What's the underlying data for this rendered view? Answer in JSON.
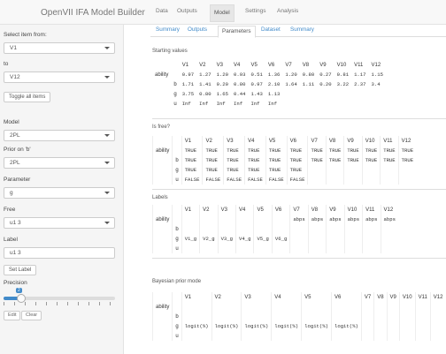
{
  "navbar": {
    "brand": "OpenVII IFA Model Builder",
    "items": [
      "Data",
      "Outputs",
      "Model",
      "Settings",
      "Analysis"
    ],
    "active_index": 2
  },
  "sidebar": {
    "select_item_label": "Select item from:",
    "select_item_value": "V1",
    "to_label": "to",
    "to_value": "V12",
    "toggle_button": "Toggle all items",
    "model_label": "Model",
    "model_value": "2PL",
    "prior_label": "Prior on 'b'",
    "prior_value": "2PL",
    "parameter_label": "Parameter",
    "parameter_value": "g",
    "free_label": "Free",
    "free_value": "u1 3",
    "label_label": "Label",
    "label_value": "u1 3",
    "set_label_button": "Set Label",
    "precision_label": "Precision",
    "slider_value": "2",
    "small_buttons": [
      "Edit",
      "Clear"
    ]
  },
  "tabs": {
    "items": [
      "Summary",
      "Outputs",
      "Parameters",
      "Dataset",
      "Summary"
    ],
    "active_index": 2
  },
  "sections": {
    "starting_values": "Starting values",
    "free": "Is free?",
    "labels": "Labels",
    "bayesian_priors": "Bayesian prior mode"
  },
  "starting_values": {
    "columns": [
      "",
      "",
      "V1",
      "V2",
      "V3",
      "V4",
      "V5",
      "V6",
      "V7",
      "V8",
      "V9",
      "V10",
      "V11",
      "V12"
    ],
    "rows": [
      [
        "ability",
        "",
        "0.97",
        "1.27",
        "1.20",
        "0.93",
        "0.51",
        "1.36",
        "1.20",
        "0.80",
        "0.27",
        "0.81",
        "1.17",
        "1.15"
      ],
      [
        "",
        "b",
        "1.71",
        "1.41",
        "0.20",
        "0.80",
        "0.97",
        "2.10",
        "1.64",
        "1.11",
        "0.20",
        "3.22",
        "2.37",
        "3.4"
      ],
      [
        "",
        "g",
        "3.75",
        "0.80",
        "1.65",
        "0.44",
        "1.43",
        "1.13",
        "",
        "",
        "",
        "",
        "",
        ""
      ],
      [
        "",
        "u",
        "Inf",
        "Inf",
        "Inf",
        "Inf",
        "Inf",
        "Inf",
        "",
        "",
        "",
        "",
        "",
        ""
      ]
    ]
  },
  "free": {
    "columns": [
      "",
      "",
      "V1",
      "V2",
      "V3",
      "V4",
      "V5",
      "V6",
      "V7",
      "V8",
      "V9",
      "V10",
      "V11",
      "V12"
    ],
    "rows": [
      [
        "ability",
        "",
        "TRUE",
        "TRUE",
        "TRUE",
        "TRUE",
        "TRUE",
        "TRUE",
        "TRUE",
        "TRUE",
        "TRUE",
        "TRUE",
        "TRUE",
        "TRUE"
      ],
      [
        "",
        "b",
        "TRUE",
        "TRUE",
        "TRUE",
        "TRUE",
        "TRUE",
        "TRUE",
        "TRUE",
        "TRUE",
        "TRUE",
        "TRUE",
        "TRUE",
        "TRUE"
      ],
      [
        "",
        "g",
        "TRUE",
        "TRUE",
        "TRUE",
        "TRUE",
        "TRUE",
        "TRUE",
        "",
        "",
        "",
        "",
        "",
        ""
      ],
      [
        "",
        "u",
        "FALSE",
        "FALSE",
        "FALSE",
        "FALSE",
        "FALSE",
        "FALSE",
        "",
        "",
        "",
        "",
        "",
        ""
      ]
    ]
  },
  "labels": {
    "columns": [
      "",
      "",
      "V1",
      "V2",
      "V3",
      "V4",
      "V5",
      "V6",
      "V7",
      "V8",
      "V9",
      "V10",
      "V11",
      "V12"
    ],
    "rows": [
      [
        "ability",
        "",
        "",
        "",
        "",
        "",
        "",
        "",
        "abps",
        "abps",
        "abps",
        "abps",
        "abps",
        "abps"
      ],
      [
        "",
        "b",
        "",
        "",
        "",
        "",
        "",
        "",
        "",
        "",
        "",
        "",
        "",
        ""
      ],
      [
        "",
        "g",
        "V1_g",
        "V2_g",
        "V3_g",
        "V4_g",
        "V5_g",
        "V6_g",
        "",
        "",
        "",
        "",
        "",
        ""
      ],
      [
        "",
        "u",
        "",
        "",
        "",
        "",
        "",
        "",
        "",
        "",
        "",
        "",
        "",
        ""
      ]
    ]
  },
  "bayesian": {
    "columns": [
      "",
      "",
      "V1",
      "V2",
      "V3",
      "V4",
      "V5",
      "V6",
      "V7",
      "V8",
      "V9",
      "V10",
      "V11",
      "V12"
    ],
    "rows": [
      [
        "ability",
        "",
        "",
        "",
        "",
        "",
        "",
        "",
        "",
        "",
        "",
        "",
        "",
        ""
      ],
      [
        "",
        "b",
        "",
        "",
        "",
        "",
        "",
        "",
        "",
        "",
        "",
        "",
        "",
        ""
      ],
      [
        "",
        "g",
        "logit(%)",
        "logit(%)",
        "logit(%)",
        "logit(%)",
        "logit(%)",
        "logit(%)",
        "",
        "",
        "",
        "",
        "",
        ""
      ],
      [
        "",
        "u",
        "",
        "",
        "",
        "",
        "",
        "",
        "",
        "",
        "",
        "",
        "",
        ""
      ]
    ]
  }
}
